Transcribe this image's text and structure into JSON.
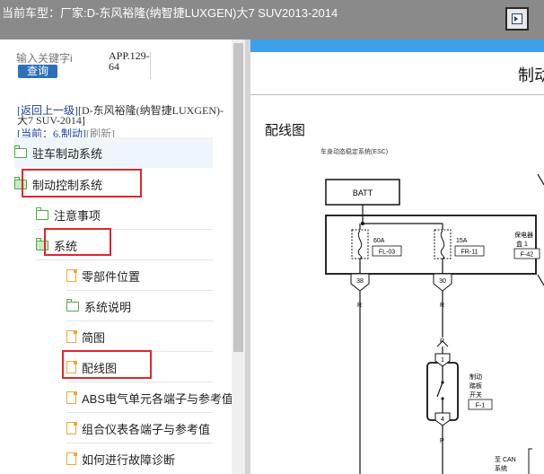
{
  "header": {
    "vehicle_label": "当前车型：",
    "vehicle_value": "厂家:D-东风裕隆(纳智捷LUXGEN)大7 SUV2013-2014",
    "toggle_icon": "expand-panel-icon"
  },
  "search": {
    "placeholder": "输入关键字i",
    "button_label": "查询",
    "app_code": "APP.129-64"
  },
  "breadcrumb": {
    "back_label": "[返回上一级]",
    "path_text": "[D-东风裕隆(纳智捷LUXGEN)-大7 SUV-2014]",
    "current_label": "[当前：",
    "current_value": "6.制动",
    "current_close": "]",
    "refresh_label": "[刷新]"
  },
  "tree": {
    "items": [
      {
        "label": "驻车制动系统",
        "icon": "folder-icon"
      },
      {
        "label": "制动控制系统",
        "icon": "folder-open-icon"
      },
      {
        "label": "注意事项",
        "icon": "folder-icon"
      },
      {
        "label": "系统",
        "icon": "folder-open-icon"
      },
      {
        "label": "零部件位置",
        "icon": "document-icon"
      },
      {
        "label": "系统说明",
        "icon": "folder-icon"
      },
      {
        "label": "简图",
        "icon": "document-icon"
      },
      {
        "label": "配线图",
        "icon": "document-icon"
      },
      {
        "label": "ABS电气单元各端子与参考值",
        "icon": "document-icon"
      },
      {
        "label": "组合仪表各端子与参考值",
        "icon": "document-icon"
      },
      {
        "label": "如何进行故障诊断",
        "icon": "document-icon"
      }
    ]
  },
  "document": {
    "title": "制动",
    "heading": "配线图",
    "subheading": "车身动态稳定系统(ESC)",
    "batt_label": "BATT",
    "fuse1_amp": "60A",
    "fuse1_code": "FL-03",
    "fuse2_amp": "15A",
    "fuse2_code": "FR-11",
    "relay_label_1": "保电器",
    "relay_label_2": "盒 1",
    "relay_code": "F-42",
    "pin_38": "38",
    "pin_30": "30",
    "wire_r1": "R",
    "wire_r2": "R",
    "wire_r3": "R",
    "wire_p": "P",
    "switch_pin_1": "1",
    "switch_pin_4": "4",
    "switch_label_1": "制动",
    "switch_label_2": "踏板",
    "switch_label_3": "开关",
    "switch_code": "F-1",
    "can_label_1": "至 CAN",
    "can_label_2": "系统"
  },
  "colors": {
    "topbar": "#8a8a8a",
    "highlight": "#e0262b",
    "accent_blue": "#3da0ea",
    "button_blue": "#2f6fb7"
  }
}
